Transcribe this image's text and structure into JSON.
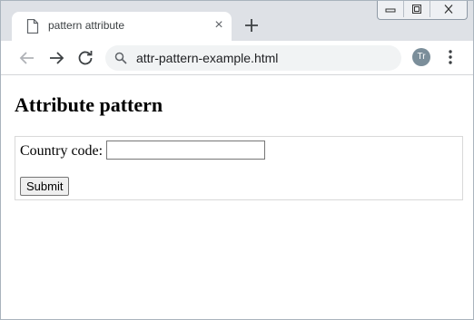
{
  "browser": {
    "tab": {
      "title": "pattern attribute",
      "close_glyph": "×",
      "icon": "document-icon"
    },
    "new_tab_icon": "plus-icon",
    "window_controls": [
      "minimize-icon",
      "restore-icon",
      "close-icon"
    ],
    "toolbar": {
      "back_icon": "arrow-left-icon",
      "forward_icon": "arrow-right-icon",
      "reload_icon": "reload-icon",
      "address": "attr-pattern-example.html",
      "profile_initials": "Tr",
      "menu_icon": "kebab-menu-icon"
    }
  },
  "page": {
    "heading": "Attribute pattern",
    "form": {
      "label": "Country code:",
      "input_value": "",
      "submit_label": "Submit"
    }
  },
  "colors": {
    "tabstrip": "#dee1e6",
    "omnibox": "#f1f3f4",
    "profile": "#7b8e9a"
  }
}
